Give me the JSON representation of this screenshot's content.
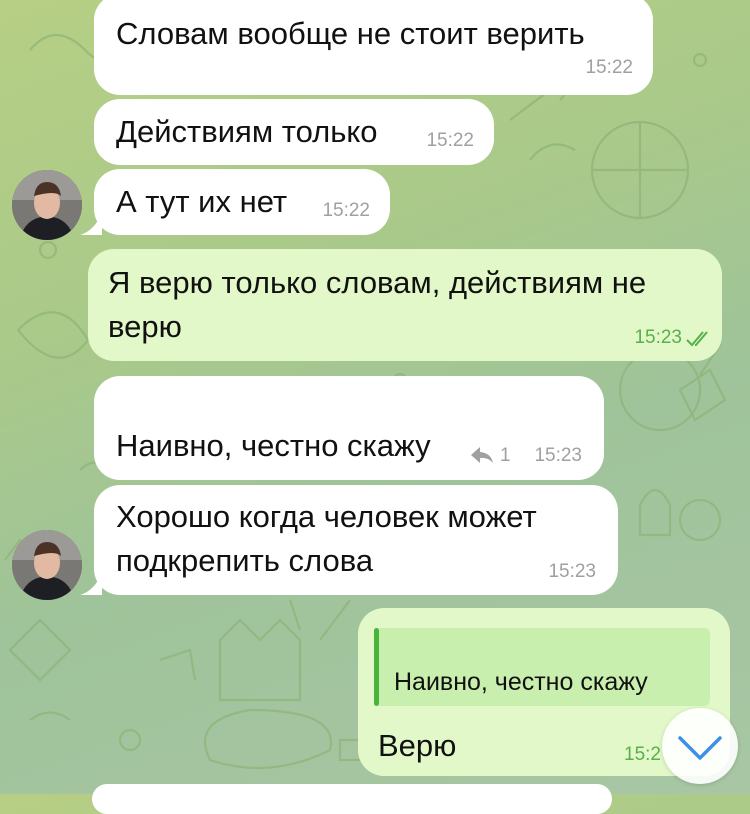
{
  "messages": [
    {
      "text": "Словам вообще не стоит верить",
      "time": "15:22"
    },
    {
      "text": "Действиям только",
      "time": "15:22"
    },
    {
      "text": "А тут их нет",
      "time": "15:22"
    },
    {
      "line1": "Я верю только словам, действиям не",
      "line2": "верю",
      "time": "15:23"
    },
    {
      "text": "Наивно, честно скажу",
      "reply_count": "1",
      "time": "15:23"
    },
    {
      "line1": "Хорошо когда человек может",
      "line2": "подкрепить слова",
      "time": "15:23"
    },
    {
      "quote": "Наивно, честно скажу",
      "text": "Верю",
      "time": "15:2"
    }
  ],
  "icons": {
    "reply": "reply-arrow-icon",
    "read": "double-check-icon",
    "scroll": "chevron-down-icon"
  },
  "colors": {
    "incoming": "#ffffff",
    "outgoing": "#e2f8c8",
    "accent": "#48b43a",
    "scroll_chevron": "#3d8fe8"
  }
}
